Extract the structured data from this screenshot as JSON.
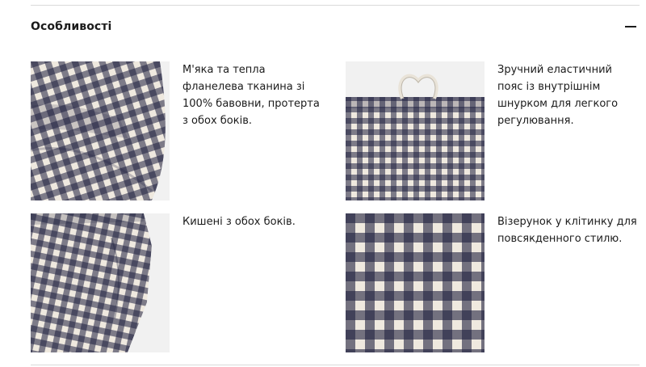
{
  "section": {
    "title": "Особливості",
    "collapse_icon": "minus-icon"
  },
  "features": [
    {
      "image": "gingham-flannel-closeup",
      "text": "М'яка та тепла фланелева тканина зі 100% бавовни, протерта з обох боків."
    },
    {
      "image": "elastic-waistband-drawstring",
      "text": "Зручний еластичний пояс із внутрішнім шнурком для легкого регулювання."
    },
    {
      "image": "side-pocket-detail",
      "text": "Кишені з обох боків."
    },
    {
      "image": "gingham-check-pattern",
      "text": "Візерунок у клітинку для повсякденного стилю."
    }
  ],
  "colors": {
    "check_dark": "#1f2140",
    "check_light": "#efe9df",
    "background": "#ffffff",
    "divider": "#dadada"
  }
}
